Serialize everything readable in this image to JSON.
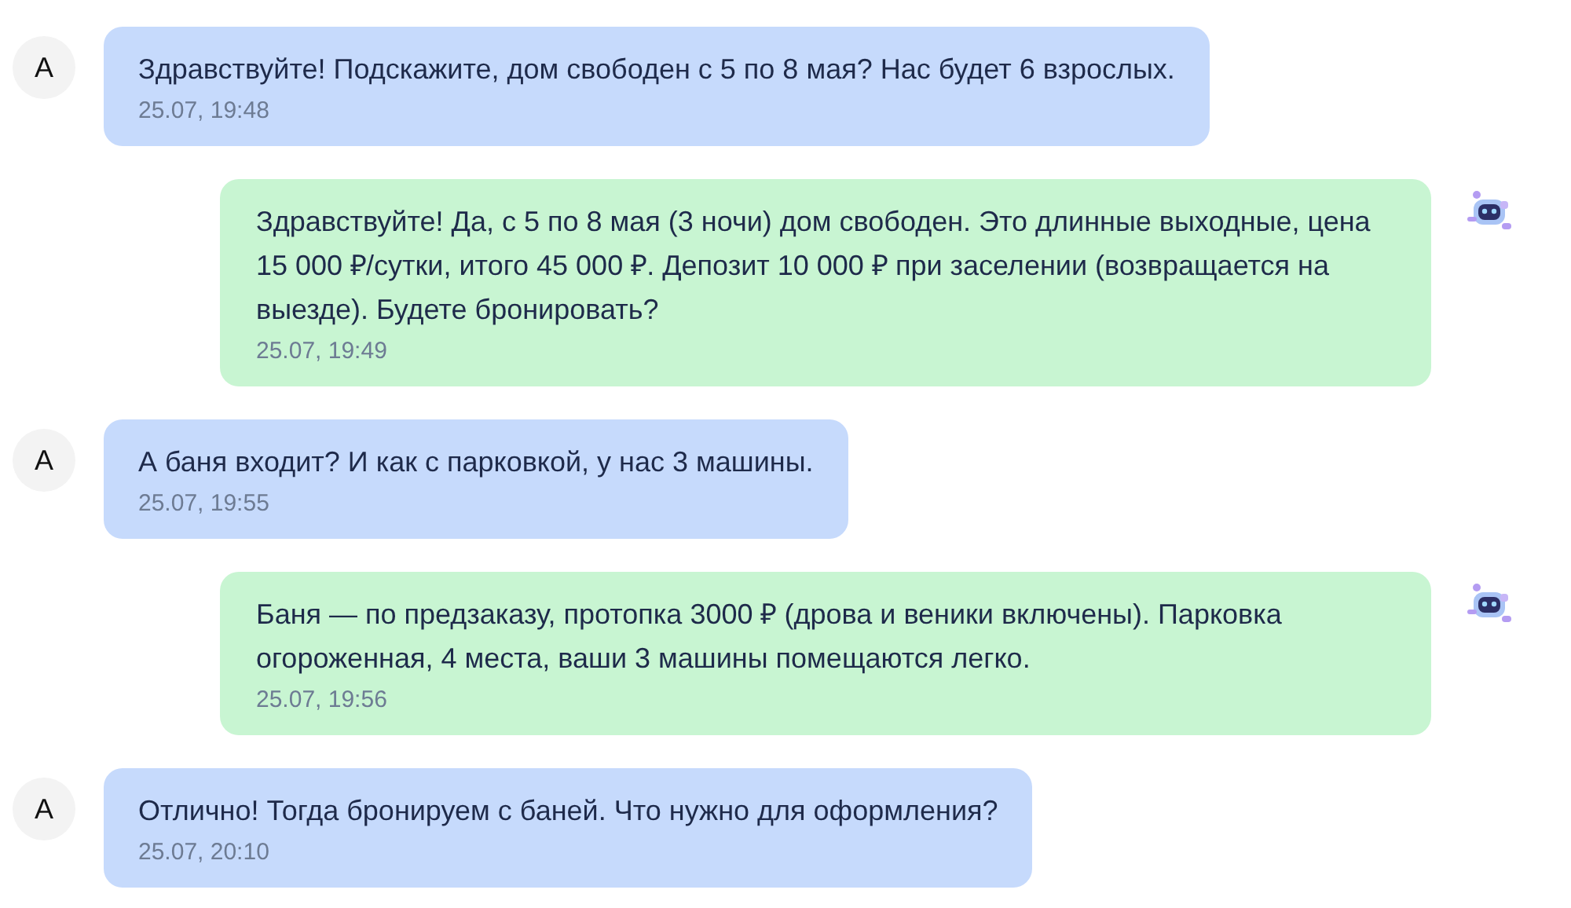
{
  "messages": [
    {
      "kind": "user",
      "avatar": "А",
      "text": "Здравствуйте! Подскажите, дом свободен с 5 по 8 мая? Нас будет 6 взрослых.",
      "time": "25.07, 19:48"
    },
    {
      "kind": "bot",
      "text": "Здравствуйте! Да, с 5 по 8 мая (3 ночи) дом свободен. Это длинные выходные, цена 15 000 ₽/сутки, итого 45 000 ₽. Депозит 10 000 ₽ при заселении (возвращается на выезде). Будете бронировать?",
      "time": "25.07, 19:49"
    },
    {
      "kind": "user",
      "avatar": "А",
      "text": "А баня входит? И как с парковкой, у нас 3 машины.",
      "time": "25.07, 19:55"
    },
    {
      "kind": "bot",
      "text": "Баня — по предзаказу, протопка 3000 ₽ (дрова и веники включены). Парковка огороженная, 4 места, ваши 3 машины помещаются легко.",
      "time": "25.07, 19:56"
    },
    {
      "kind": "user",
      "avatar": "А",
      "text": "Отлично! Тогда бронируем с баней. Что нужно для оформления?",
      "time": "25.07, 20:10"
    }
  ]
}
